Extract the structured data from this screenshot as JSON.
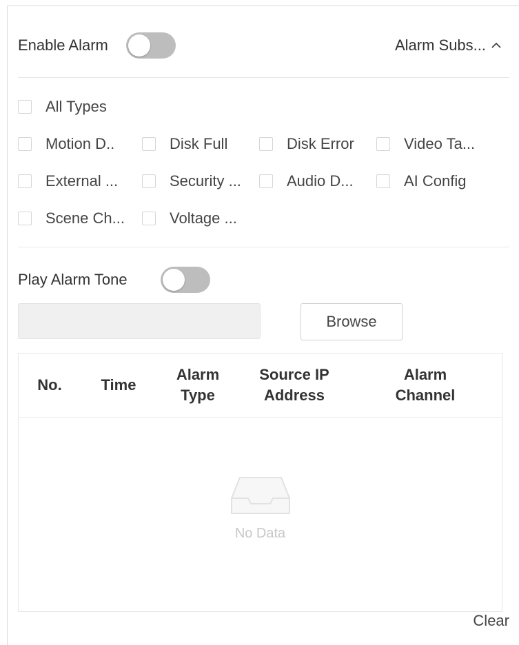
{
  "alarm": {
    "enable_label": "Enable Alarm",
    "enable_on": false,
    "subscribe_label": "Alarm Subs..."
  },
  "types": {
    "rows": [
      [
        "All Types"
      ],
      [
        "Motion D..",
        "Disk Full",
        "Disk Error",
        "Video Ta..."
      ],
      [
        "External ...",
        "Security ...",
        "Audio D...",
        "AI Config"
      ],
      [
        "Scene Ch...",
        "Voltage ..."
      ]
    ]
  },
  "tone": {
    "label": "Play Alarm Tone",
    "on": false,
    "browse_label": "Browse",
    "file_value": ""
  },
  "table": {
    "columns": [
      [
        "No."
      ],
      [
        "Time"
      ],
      [
        "Alarm",
        "Type"
      ],
      [
        "Source IP",
        "Address"
      ],
      [
        "Alarm",
        "Channel"
      ]
    ],
    "empty_text": "No Data"
  },
  "footer": {
    "clear_label": "Clear"
  },
  "colors": {
    "toggle_off": "#bdbdbd",
    "border": "#d9d9d9"
  },
  "icons": {
    "subscribe_chevron": "chevron-up-icon",
    "empty": "inbox-icon"
  }
}
